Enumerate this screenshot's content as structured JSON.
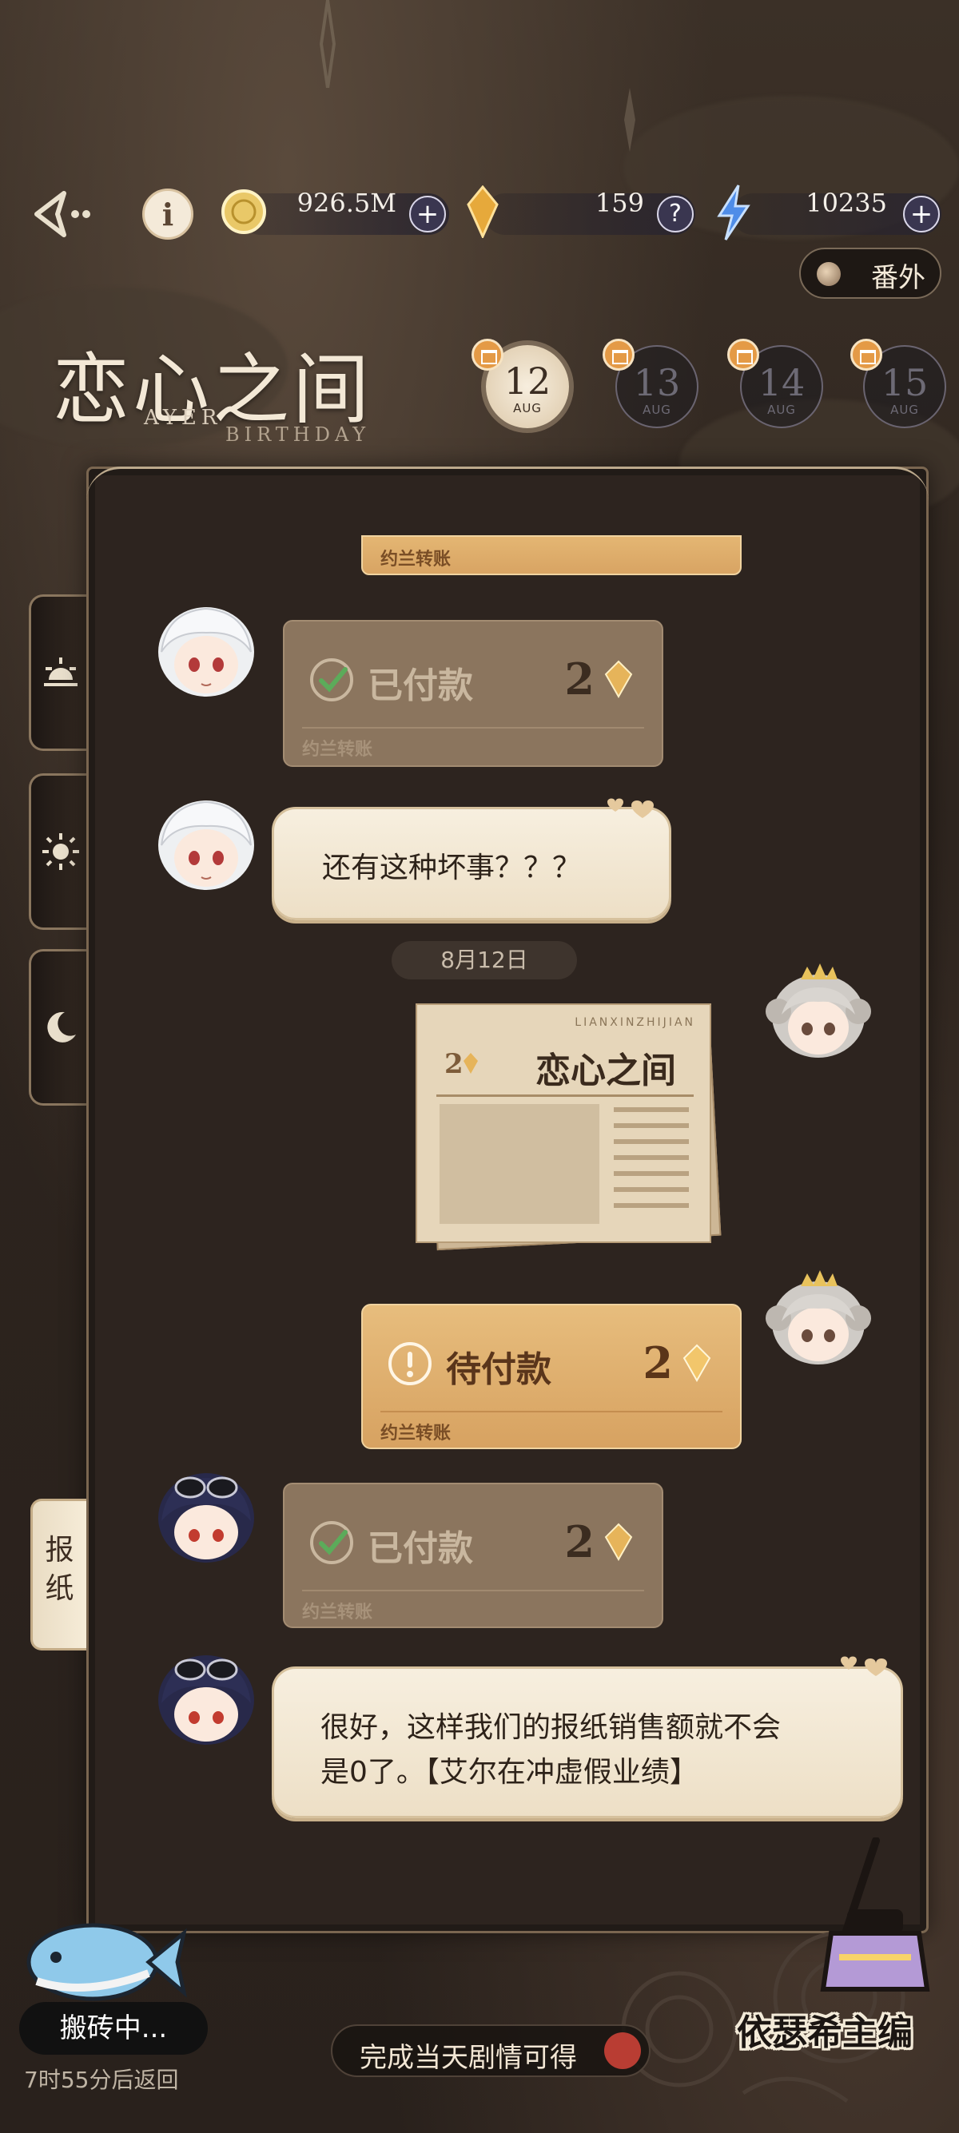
{
  "colors": {
    "accent_gold": "#d7a261",
    "panel": "#2d241f",
    "bubble": "#f7efdf",
    "lightning": "#4f8de8"
  },
  "topbar": {
    "coins": "926.5M",
    "gems": "159",
    "energy": "10235"
  },
  "extra_button": "番外",
  "event": {
    "title": "恋心之间",
    "subtitle_name": "AYER",
    "subtitle_event": "BIRTHDAY",
    "days": [
      {
        "num": "12",
        "month": "AUG",
        "active": true
      },
      {
        "num": "13",
        "month": "AUG",
        "active": false
      },
      {
        "num": "14",
        "month": "AUG",
        "active": false
      },
      {
        "num": "15",
        "month": "AUG",
        "active": false
      }
    ]
  },
  "sidebar": {
    "tabs": [
      {
        "icon": "sunrise-icon"
      },
      {
        "icon": "sun-icon"
      },
      {
        "icon": "moon-icon"
      }
    ],
    "newspaper_tab": "报纸"
  },
  "chat": {
    "partial_label": "约兰转账",
    "messages": [
      {
        "type": "payment",
        "status": "已付款",
        "amount": "2",
        "label": "约兰转账"
      },
      {
        "type": "text",
        "text": "还有这种坏事？？？"
      },
      {
        "type": "date",
        "text": "8月12日"
      },
      {
        "type": "newspaper",
        "header": "LIANXINZHIJIAN",
        "title": "恋心之间",
        "price": "2"
      },
      {
        "type": "payment",
        "status": "待付款",
        "amount": "2",
        "label": "约兰转账"
      },
      {
        "type": "payment",
        "status": "已付款",
        "amount": "2",
        "label": "约兰转账"
      },
      {
        "type": "text",
        "text_line1": "很好，这样我们的报纸销售额就不会",
        "text_line2": "是0了。【艾尔在冲虚假业绩】"
      }
    ]
  },
  "bottom": {
    "fish_status": "搬砖中...",
    "fish_return": "7时55分后返回",
    "reward_hint": "完成当天剧情可得",
    "editor": "依瑟希主编"
  }
}
